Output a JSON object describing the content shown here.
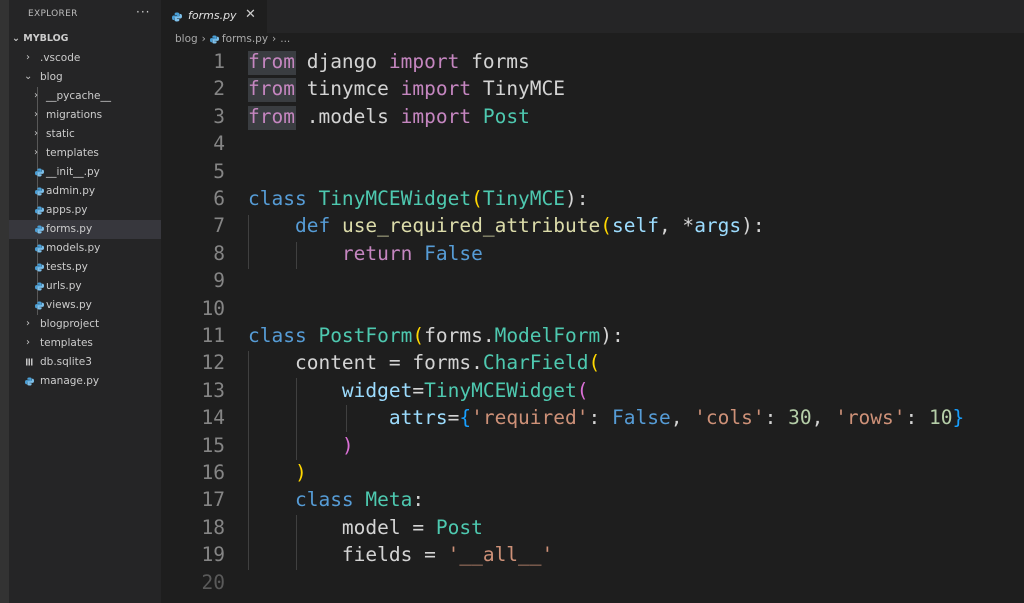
{
  "sidebar": {
    "title": "EXPLORER",
    "more": "···",
    "root": "MYBLOG",
    "items": [
      {
        "label": ".vscode",
        "type": "folder"
      },
      {
        "label": "blog",
        "type": "folder-open"
      },
      {
        "label": "__pycache__",
        "type": "folder"
      },
      {
        "label": "migrations",
        "type": "folder"
      },
      {
        "label": "static",
        "type": "folder"
      },
      {
        "label": "templates",
        "type": "folder"
      },
      {
        "label": "__init__.py",
        "type": "python-file"
      },
      {
        "label": "admin.py",
        "type": "python-file"
      },
      {
        "label": "apps.py",
        "type": "python-file"
      },
      {
        "label": "forms.py",
        "type": "python-file",
        "active": true
      },
      {
        "label": "models.py",
        "type": "python-file"
      },
      {
        "label": "tests.py",
        "type": "python-file"
      },
      {
        "label": "urls.py",
        "type": "python-file"
      },
      {
        "label": "views.py",
        "type": "python-file"
      },
      {
        "label": "blogproject",
        "type": "folder"
      },
      {
        "label": "templates",
        "type": "folder"
      },
      {
        "label": "db.sqlite3",
        "type": "database-file"
      },
      {
        "label": "manage.py",
        "type": "python-file"
      }
    ]
  },
  "tab": {
    "label": "forms.py",
    "close": "✕"
  },
  "breadcrumb": {
    "folder": "blog",
    "file": "forms.py",
    "rest": "..."
  },
  "code": {
    "line_numbers": [
      "1",
      "2",
      "3",
      "4",
      "5",
      "6",
      "7",
      "8",
      "9",
      "10",
      "11",
      "12",
      "13",
      "14",
      "15",
      "16",
      "17",
      "18",
      "19",
      "20"
    ],
    "current_line": "20",
    "tokens": {
      "l1": [
        "from",
        " django ",
        "import",
        " forms"
      ],
      "l2": [
        "from",
        " tinymce ",
        "import",
        " TinyMCE"
      ],
      "l3": [
        "from",
        " .models ",
        "import",
        " ",
        "Post"
      ],
      "l6": [
        "class",
        " ",
        "TinyMCEWidget",
        "(",
        "TinyMCE",
        "):"
      ],
      "l7": [
        "    ",
        "def",
        " ",
        "use_required_attribute",
        "(",
        "self",
        ", *",
        "args",
        "):"
      ],
      "l8": [
        "        ",
        "return",
        " ",
        "False"
      ],
      "l11": [
        "class",
        " ",
        "PostForm",
        "(",
        "forms",
        ".",
        "ModelForm",
        "):"
      ],
      "l12": [
        "    ",
        "content",
        " = ",
        "forms",
        ".",
        "CharField",
        "("
      ],
      "l13": [
        "        ",
        "widget",
        "=",
        "TinyMCEWidget",
        "("
      ],
      "l14": [
        "            ",
        "attrs",
        "=",
        "{",
        "'required'",
        ": ",
        "False",
        ", ",
        "'cols'",
        ": ",
        "30",
        ", ",
        "'rows'",
        ": ",
        "10",
        "}"
      ],
      "l15": [
        "        ",
        ")"
      ],
      "l16": [
        "    ",
        ")"
      ],
      "l17": [
        "    ",
        "class",
        " ",
        "Meta",
        ":"
      ],
      "l18": [
        "        ",
        "model",
        " = ",
        "Post"
      ],
      "l19": [
        "        ",
        "fields",
        " = ",
        "'__all__'"
      ]
    }
  },
  "colors": {
    "keyword": "#c586c0",
    "storage": "#569cd6",
    "class": "#4ec9b0",
    "function": "#dcdcaa",
    "parameter": "#9cdcfe",
    "string": "#ce9178",
    "number": "#b5cea8"
  }
}
